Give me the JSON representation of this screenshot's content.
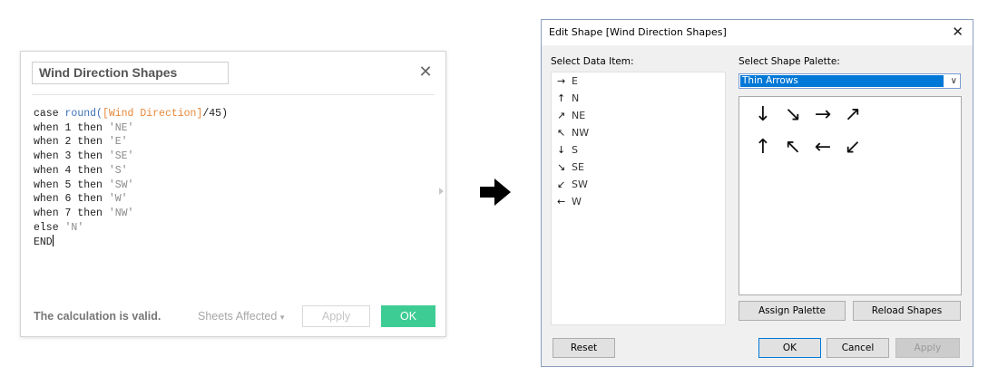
{
  "calc_editor": {
    "name": "Wind Direction Shapes",
    "close_glyph": "✕",
    "code_lines": [
      [
        {
          "t": "case ",
          "c": "kw"
        },
        {
          "t": "round(",
          "c": "fn"
        },
        {
          "t": "[Wind Direction]",
          "c": "fld"
        },
        {
          "t": "/45)",
          "c": "kw"
        }
      ],
      [
        {
          "t": "when 1 then ",
          "c": "kw"
        },
        {
          "t": "'NE'",
          "c": "str"
        }
      ],
      [
        {
          "t": "when 2 then ",
          "c": "kw"
        },
        {
          "t": "'E'",
          "c": "str"
        }
      ],
      [
        {
          "t": "when 3 then ",
          "c": "kw"
        },
        {
          "t": "'SE'",
          "c": "str"
        }
      ],
      [
        {
          "t": "when 4 then ",
          "c": "kw"
        },
        {
          "t": "'S'",
          "c": "str"
        }
      ],
      [
        {
          "t": "when 5 then ",
          "c": "kw"
        },
        {
          "t": "'SW'",
          "c": "str"
        }
      ],
      [
        {
          "t": "when 6 then ",
          "c": "kw"
        },
        {
          "t": "'W'",
          "c": "str"
        }
      ],
      [
        {
          "t": "when 7 then ",
          "c": "kw"
        },
        {
          "t": "'NW'",
          "c": "str"
        }
      ],
      [
        {
          "t": "else ",
          "c": "kw"
        },
        {
          "t": "'N'",
          "c": "str"
        }
      ],
      [
        {
          "t": "END",
          "c": "kw"
        }
      ]
    ],
    "status": "The calculation is valid.",
    "sheets_affected": "Sheets Affected",
    "sheets_affected_caret": "▾",
    "apply_label": "Apply",
    "ok_label": "OK"
  },
  "colors": {
    "ok_green": "#3ecc95",
    "function_blue": "#3c73b8",
    "field_orange": "#e8883a",
    "string_gray": "#8a8a8a",
    "selection_blue": "#0078d7"
  },
  "dialog": {
    "title": "Edit Shape [Wind Direction Shapes]",
    "close_glyph": "✕",
    "select_data_item_label": "Select Data Item:",
    "select_shape_palette_label": "Select Shape Palette:",
    "data_items": [
      {
        "icon": "→",
        "icon_name": "arrow-right-icon",
        "label": "E"
      },
      {
        "icon": "↑",
        "icon_name": "arrow-up-icon",
        "label": "N"
      },
      {
        "icon": "↗",
        "icon_name": "arrow-up-right-icon",
        "label": "NE"
      },
      {
        "icon": "↖",
        "icon_name": "arrow-up-left-icon",
        "label": "NW"
      },
      {
        "icon": "↓",
        "icon_name": "arrow-down-icon",
        "label": "S"
      },
      {
        "icon": "↘",
        "icon_name": "arrow-down-right-icon",
        "label": "SE"
      },
      {
        "icon": "↙",
        "icon_name": "arrow-down-left-icon",
        "label": "SW"
      },
      {
        "icon": "←",
        "icon_name": "arrow-left-icon",
        "label": "W"
      }
    ],
    "palette_selected": "Thin Arrows",
    "palette_dropdown_glyph": "∨",
    "shapes": [
      {
        "glyph": "↓",
        "name": "shape-arrow-down-icon"
      },
      {
        "glyph": "↘",
        "name": "shape-arrow-down-right-icon"
      },
      {
        "glyph": "→",
        "name": "shape-arrow-right-icon"
      },
      {
        "glyph": "↗",
        "name": "shape-arrow-up-right-icon"
      },
      {
        "glyph": "↑",
        "name": "shape-arrow-up-icon"
      },
      {
        "glyph": "↖",
        "name": "shape-arrow-up-left-icon"
      },
      {
        "glyph": "←",
        "name": "shape-arrow-left-icon"
      },
      {
        "glyph": "↙",
        "name": "shape-arrow-down-left-icon"
      }
    ],
    "assign_palette_label": "Assign Palette",
    "reload_shapes_label": "Reload Shapes",
    "reset_label": "Reset",
    "ok_label": "OK",
    "cancel_label": "Cancel",
    "apply_label": "Apply"
  }
}
